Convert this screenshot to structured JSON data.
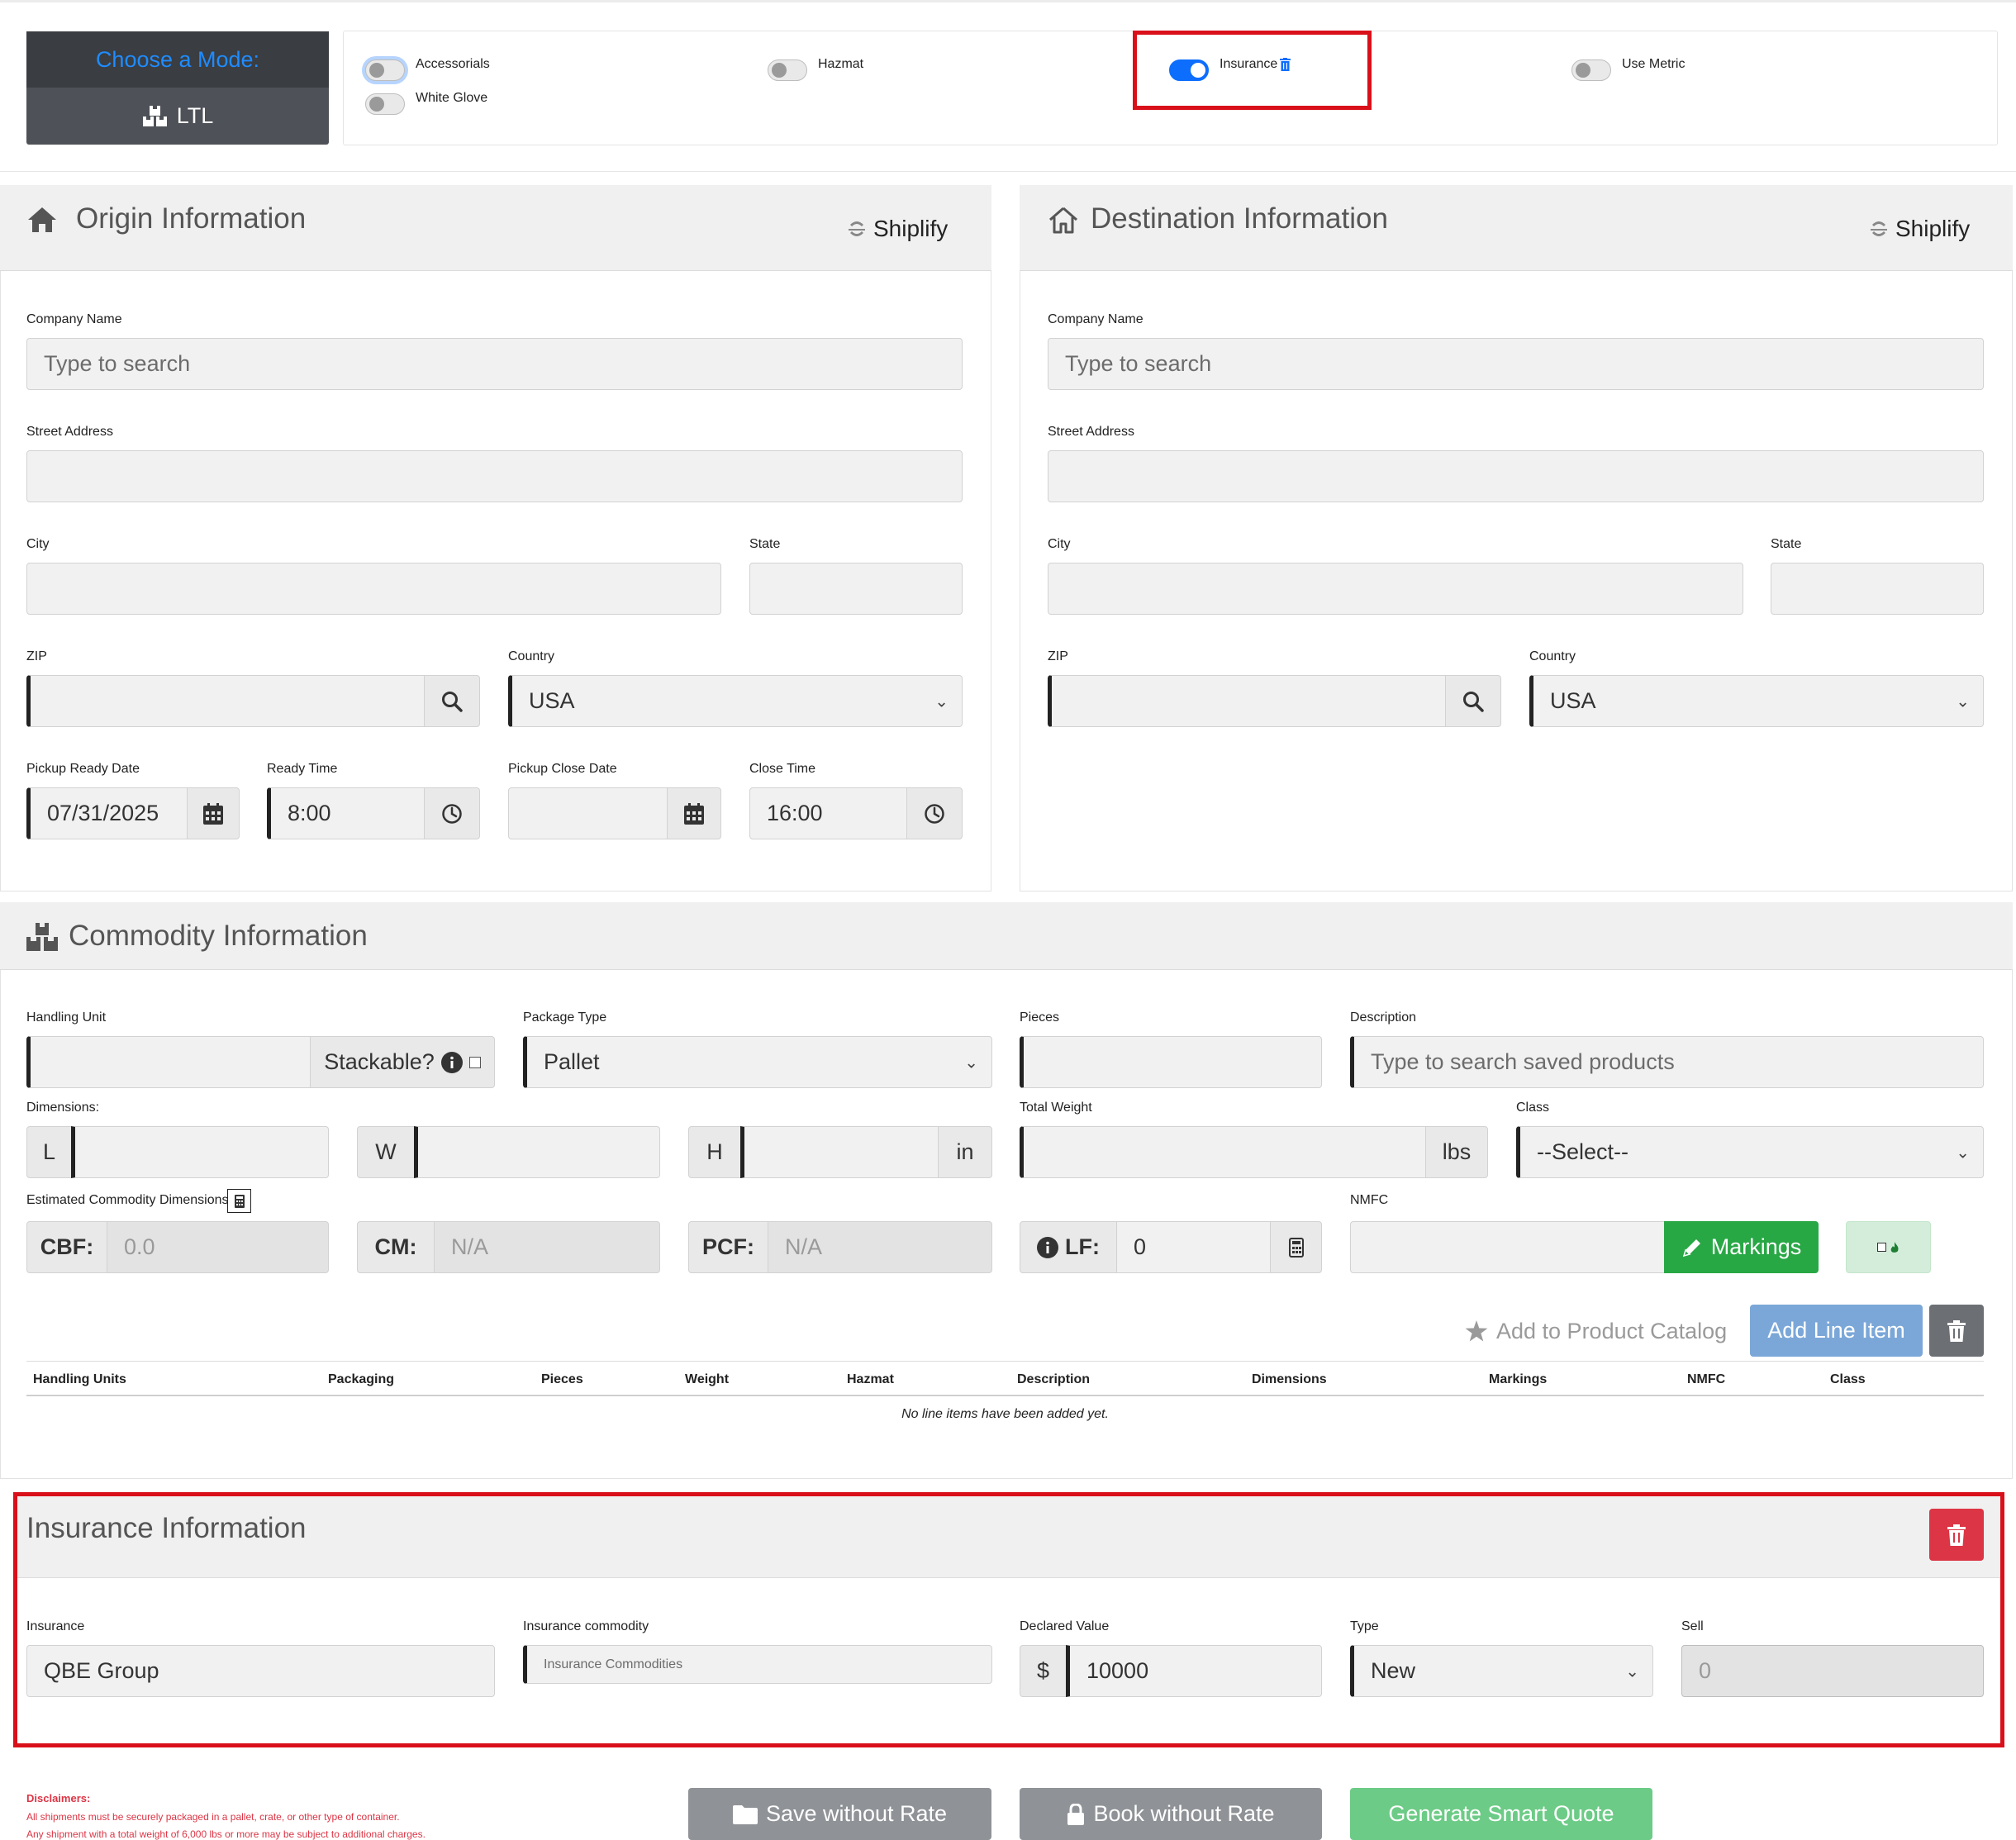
{
  "mode": {
    "label": "Choose a Mode:",
    "value": "LTL",
    "icon": "boxes-icon"
  },
  "toggles": {
    "accessorials": {
      "label": "Accessorials",
      "on": false
    },
    "white_glove": {
      "label": "White Glove",
      "on": false
    },
    "hazmat": {
      "label": "Hazmat",
      "on": false
    },
    "insurance": {
      "label": "Insurance",
      "on": true
    },
    "use_metric": {
      "label": "Use Metric",
      "on": false
    }
  },
  "origin": {
    "title": "Origin Information",
    "shiplify": "Shiplify",
    "company_label": "Company Name",
    "company_placeholder": "Type to search",
    "street_label": "Street Address",
    "city_label": "City",
    "state_label": "State",
    "zip_label": "ZIP",
    "country_label": "Country",
    "country_value": "USA",
    "pickup_ready_date_label": "Pickup Ready Date",
    "pickup_ready_date": "07/31/2025",
    "ready_time_label": "Ready Time",
    "ready_time": "8:00",
    "pickup_close_date_label": "Pickup Close Date",
    "close_time_label": "Close Time",
    "close_time": "16:00"
  },
  "destination": {
    "title": "Destination Information",
    "shiplify": "Shiplify",
    "company_label": "Company Name",
    "company_placeholder": "Type to search",
    "street_label": "Street Address",
    "city_label": "City",
    "state_label": "State",
    "zip_label": "ZIP",
    "country_label": "Country",
    "country_value": "USA"
  },
  "commodity": {
    "title": "Commodity Information",
    "handling_unit_label": "Handling Unit",
    "stackable_label": "Stackable?",
    "package_type_label": "Package Type",
    "package_type": "Pallet",
    "pieces_label": "Pieces",
    "description_label": "Description",
    "description_placeholder": "Type to search saved products",
    "dimensions_label": "Dimensions:",
    "dim_l": "L",
    "dim_w": "W",
    "dim_h": "H",
    "dim_unit": "in",
    "total_weight_label": "Total Weight",
    "weight_unit": "lbs",
    "class_label": "Class",
    "class_value": "--Select--",
    "estimated_label": "Estimated Commodity Dimensions",
    "cbf_label": "CBF:",
    "cbf_placeholder": "0.0",
    "cm_label": "CM:",
    "cm_placeholder": "N/A",
    "pcf_label": "PCF:",
    "pcf_placeholder": "N/A",
    "lf_label": "LF:",
    "lf_value": "0",
    "nmfc_label": "NMFC",
    "markings_label": "Markings",
    "add_catalog_label": "Add to Product Catalog",
    "add_line_label": "Add Line Item",
    "table_headers": [
      "Handling Units",
      "Packaging",
      "Pieces",
      "Weight",
      "Hazmat",
      "Description",
      "Dimensions",
      "Markings",
      "NMFC",
      "Class"
    ],
    "empty_message": "No line items have been added yet."
  },
  "insurance": {
    "title": "Insurance Information",
    "insurance_label": "Insurance",
    "insurance_value": "QBE Group",
    "commodity_label": "Insurance commodity",
    "commodity_placeholder": "Insurance Commodities",
    "declared_label": "Declared Value",
    "currency": "$",
    "declared_value": "10000",
    "type_label": "Type",
    "type_value": "New",
    "sell_label": "Sell",
    "sell_placeholder": "0"
  },
  "footer": {
    "disclaimer_title": "Disclaimers:",
    "disclaimer_1": "All shipments must be securely packaged in a pallet, crate, or other type of container.",
    "disclaimer_2": "Any shipment with a total weight of 6,000 lbs or more may be subject to additional charges.",
    "save_label": "Save without Rate",
    "book_label": "Book without Rate",
    "generate_label": "Generate Smart Quote"
  },
  "colors": {
    "primary": "#0d6efd",
    "highlight": "#d9101a",
    "success": "#28a745",
    "danger": "#dc3545",
    "secondary": "#8f9296"
  }
}
